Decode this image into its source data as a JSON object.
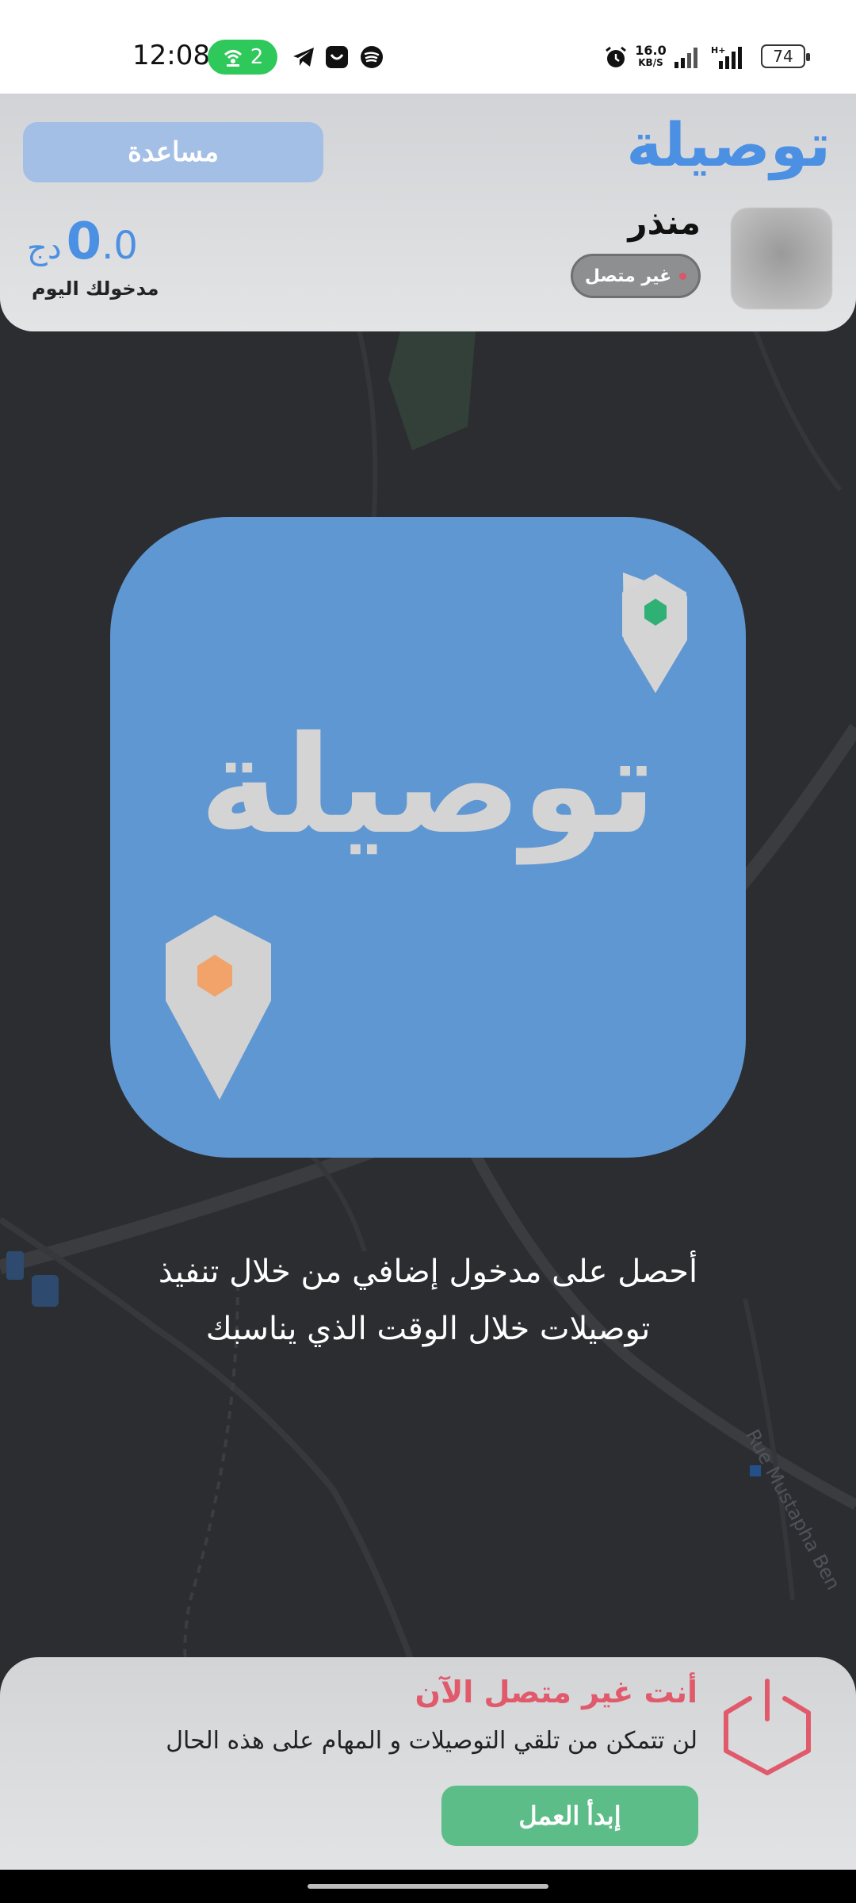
{
  "status_bar": {
    "time": "12:08",
    "hotspot_count": "2",
    "net_speed_value": "16.0",
    "net_speed_unit": "KB/S",
    "battery": "74",
    "icons": [
      "wifi-hotspot-icon",
      "telegram-icon",
      "smile-app-icon",
      "spotify-icon",
      "alarm-icon",
      "signal-icon",
      "signal-h-plus-icon"
    ]
  },
  "header": {
    "app_title": "توصيلة",
    "help_label": "مساعدة",
    "user_name": "منذر",
    "status_badge": "غير متصل",
    "earnings_int": "0",
    "earnings_dec": ".0",
    "earnings_currency": "دج",
    "earnings_label": "مدخولك اليوم"
  },
  "logo": {
    "text": "توصيلة",
    "green_pin_color": "#2fb074",
    "orange_pin_color": "#f2a36a"
  },
  "tagline": {
    "line1": "أحصل على مدخول إضافي من خلال تنفيذ",
    "line2": "توصيلات خلال الوقت الذي يناسبك"
  },
  "map": {
    "street_label": "Rue Mustapha Ben"
  },
  "offline_panel": {
    "title": "أنت غير متصل الآن",
    "description": "لن تتمكن من تلقي التوصيلات و المهام على هذه الحال",
    "start_label": "إبدأ العمل"
  },
  "colors": {
    "accent": "#4b90e2",
    "offline_red": "#e15a6c",
    "start_green": "#5cbd88",
    "map_bg": "#2b2d31"
  }
}
